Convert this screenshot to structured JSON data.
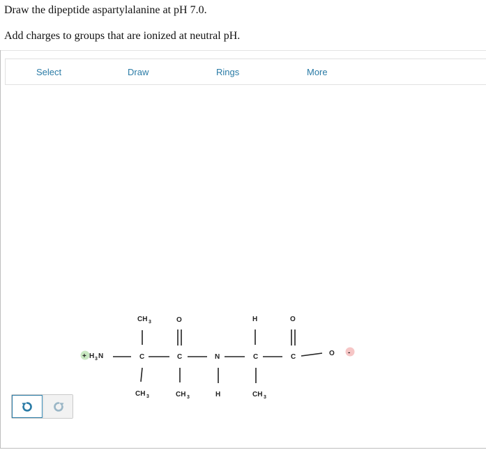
{
  "question": {
    "line1": "Draw the dipeptide aspartylalanine at pH 7.0.",
    "line2": "Add charges to groups that are ionized at neutral pH."
  },
  "toolbar": {
    "items": [
      "Select",
      "Draw",
      "Rings",
      "More"
    ]
  },
  "history": {
    "undo_icon": "undo-icon",
    "redo_icon": "redo-icon"
  },
  "molecule": {
    "atoms": {
      "n_terminus_plus": "+",
      "n_terminus_h": "H",
      "n_terminus_sub": "3",
      "n_terminus_n": "N",
      "c_alpha1": "C",
      "c_alpha1_top": "CH",
      "c_alpha1_top_sub": "3",
      "c_alpha1_bottom": "CH",
      "c_alpha1_bottom_sub": "3",
      "c_carbonyl1": "C",
      "o_carbonyl1": "O",
      "c_carbonyl1_bottom": "CH",
      "c_carbonyl1_bottom_sub": "3",
      "n_amide": "N",
      "n_amide_h": "H",
      "c_alpha2": "C",
      "c_alpha2_h": "H",
      "c_alpha2_bottom": "CH",
      "c_alpha2_bottom_sub": "3",
      "c_carbonyl2": "C",
      "o_carbonyl2": "O",
      "o_carboxylate": "O",
      "carboxylate_minus": "-"
    },
    "colors": {
      "positive_charge_bg": "#c9e8c2",
      "negative_charge_bg": "#f6c6c6",
      "accent": "#2a7ba6"
    }
  }
}
